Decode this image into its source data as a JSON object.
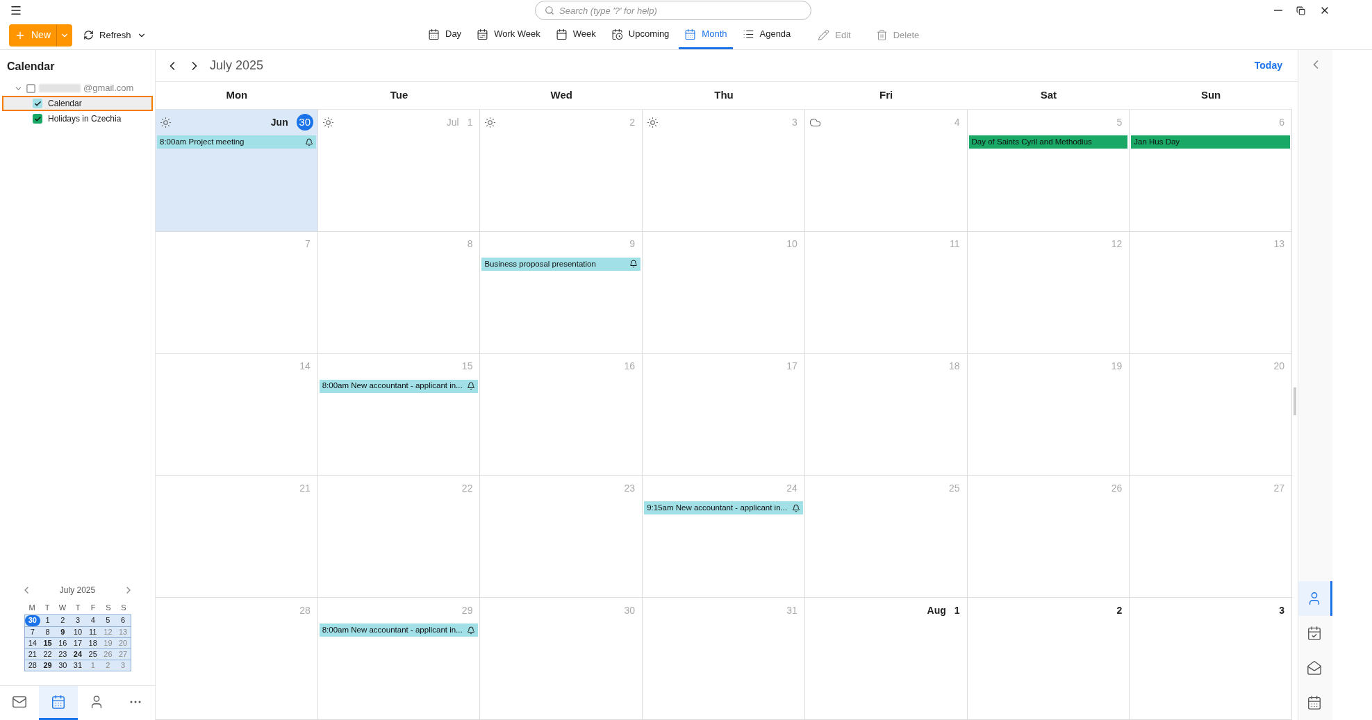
{
  "search": {
    "placeholder": "Search (type '?' for help)"
  },
  "toolbar": {
    "new_button": "New",
    "refresh_button": "Refresh",
    "views": [
      {
        "kind": "day",
        "label": "Day",
        "selected": false
      },
      {
        "kind": "workweek",
        "label": "Work Week",
        "selected": false
      },
      {
        "kind": "week",
        "label": "Week",
        "selected": false
      },
      {
        "kind": "upcoming",
        "label": "Upcoming",
        "selected": false
      },
      {
        "kind": "month",
        "label": "Month",
        "selected": true
      },
      {
        "kind": "agenda",
        "label": "Agenda",
        "selected": false
      }
    ],
    "actions": [
      {
        "kind": "edit",
        "label": "Edit",
        "disabled": true
      },
      {
        "kind": "delete",
        "label": "Delete",
        "disabled": true
      }
    ]
  },
  "sidebar": {
    "title": "Calendar",
    "account": {
      "label": "@gmail.com",
      "expanded": true,
      "calendars": [
        {
          "name": "Calendar",
          "checked": true,
          "selected": true,
          "color": "#a0e0e6"
        },
        {
          "name": "Holidays in Czechia",
          "checked": true,
          "selected": false,
          "color": "#1aa866"
        }
      ]
    },
    "mini_calendar": {
      "title": "July 2025",
      "weekdays": [
        "M",
        "T",
        "W",
        "T",
        "F",
        "S",
        "S"
      ],
      "weeks": [
        [
          {
            "day": "30",
            "today": true,
            "bold": false,
            "dimmed": false
          },
          {
            "day": "1",
            "today": false,
            "bold": false,
            "dimmed": false
          },
          {
            "day": "2",
            "today": false,
            "bold": false,
            "dimmed": false
          },
          {
            "day": "3",
            "today": false,
            "bold": false,
            "dimmed": false
          },
          {
            "day": "4",
            "today": false,
            "bold": false,
            "dimmed": false
          },
          {
            "day": "5",
            "today": false,
            "bold": false,
            "dimmed": false
          },
          {
            "day": "6",
            "today": false,
            "bold": false,
            "dimmed": false
          }
        ],
        [
          {
            "day": "7",
            "today": false,
            "bold": false,
            "dimmed": false
          },
          {
            "day": "8",
            "today": false,
            "bold": false,
            "dimmed": false
          },
          {
            "day": "9",
            "today": false,
            "bold": true,
            "dimmed": false
          },
          {
            "day": "10",
            "today": false,
            "bold": false,
            "dimmed": false
          },
          {
            "day": "11",
            "today": false,
            "bold": false,
            "dimmed": false
          },
          {
            "day": "12",
            "today": false,
            "bold": false,
            "dimmed": true
          },
          {
            "day": "13",
            "today": false,
            "bold": false,
            "dimmed": true
          }
        ],
        [
          {
            "day": "14",
            "today": false,
            "bold": false,
            "dimmed": false
          },
          {
            "day": "15",
            "today": false,
            "bold": true,
            "dimmed": false
          },
          {
            "day": "16",
            "today": false,
            "bold": false,
            "dimmed": false
          },
          {
            "day": "17",
            "today": false,
            "bold": false,
            "dimmed": false
          },
          {
            "day": "18",
            "today": false,
            "bold": false,
            "dimmed": false
          },
          {
            "day": "19",
            "today": false,
            "bold": false,
            "dimmed": true
          },
          {
            "day": "20",
            "today": false,
            "bold": false,
            "dimmed": true
          }
        ],
        [
          {
            "day": "21",
            "today": false,
            "bold": false,
            "dimmed": false
          },
          {
            "day": "22",
            "today": false,
            "bold": false,
            "dimmed": false
          },
          {
            "day": "23",
            "today": false,
            "bold": false,
            "dimmed": false
          },
          {
            "day": "24",
            "today": false,
            "bold": true,
            "dimmed": false
          },
          {
            "day": "25",
            "today": false,
            "bold": false,
            "dimmed": false
          },
          {
            "day": "26",
            "today": false,
            "bold": false,
            "dimmed": true
          },
          {
            "day": "27",
            "today": false,
            "bold": false,
            "dimmed": true
          }
        ],
        [
          {
            "day": "28",
            "today": false,
            "bold": false,
            "dimmed": false
          },
          {
            "day": "29",
            "today": false,
            "bold": true,
            "dimmed": false
          },
          {
            "day": "30",
            "today": false,
            "bold": false,
            "dimmed": false
          },
          {
            "day": "31",
            "today": false,
            "bold": false,
            "dimmed": false
          },
          {
            "day": "1",
            "today": false,
            "bold": false,
            "dimmed": true
          },
          {
            "day": "2",
            "today": false,
            "bold": false,
            "dimmed": true
          },
          {
            "day": "3",
            "today": false,
            "bold": false,
            "dimmed": true
          }
        ]
      ]
    }
  },
  "bottom_nav": [
    {
      "kind": "mail",
      "selected": false
    },
    {
      "kind": "calendar",
      "selected": true
    },
    {
      "kind": "contacts",
      "selected": false
    },
    {
      "kind": "more",
      "selected": false
    }
  ],
  "calendar": {
    "title": "July 2025",
    "today_button": "Today",
    "weekdays": [
      "Mon",
      "Tue",
      "Wed",
      "Thu",
      "Fri",
      "Sat",
      "Sun"
    ],
    "weeks": [
      [
        {
          "month": "Jun",
          "day": "30",
          "today": true,
          "dimmed": false,
          "weather": {
            "kind": "sun"
          },
          "events": [
            {
              "text": "8:00am Project meeting",
              "reminder": true,
              "color": "#a0e0e6"
            }
          ]
        },
        {
          "month": "Jul",
          "day": "1",
          "today": false,
          "dimmed": true,
          "weather": {
            "kind": "sun"
          }
        },
        {
          "day": "2",
          "today": false,
          "dimmed": true,
          "weather": {
            "kind": "sun"
          }
        },
        {
          "day": "3",
          "today": false,
          "dimmed": true,
          "weather": {
            "kind": "sun"
          }
        },
        {
          "day": "4",
          "today": false,
          "dimmed": true,
          "weather": {
            "kind": "cloud"
          }
        },
        {
          "day": "5",
          "today": false,
          "dimmed": true,
          "events": [
            {
              "text": "Day of Saints Cyril and Methodius",
              "reminder": false,
              "color": "#1aa866"
            }
          ]
        },
        {
          "day": "6",
          "today": false,
          "dimmed": true,
          "events": [
            {
              "text": "Jan Hus Day",
              "reminder": false,
              "color": "#1aa866"
            }
          ]
        }
      ],
      [
        {
          "day": "7",
          "today": false,
          "dimmed": true
        },
        {
          "day": "8",
          "today": false,
          "dimmed": true
        },
        {
          "day": "9",
          "today": false,
          "dimmed": true,
          "events": [
            {
              "text": "Business proposal presentation",
              "reminder": true,
              "color": "#a0e0e6"
            }
          ]
        },
        {
          "day": "10",
          "today": false,
          "dimmed": true
        },
        {
          "day": "11",
          "today": false,
          "dimmed": true
        },
        {
          "day": "12",
          "today": false,
          "dimmed": true
        },
        {
          "day": "13",
          "today": false,
          "dimmed": true
        }
      ],
      [
        {
          "day": "14",
          "today": false,
          "dimmed": true
        },
        {
          "day": "15",
          "today": false,
          "dimmed": true,
          "events": [
            {
              "text": "8:00am New accountant - applicant in...",
              "reminder": true,
              "color": "#a0e0e6"
            }
          ]
        },
        {
          "day": "16",
          "today": false,
          "dimmed": true
        },
        {
          "day": "17",
          "today": false,
          "dimmed": true
        },
        {
          "day": "18",
          "today": false,
          "dimmed": true
        },
        {
          "day": "19",
          "today": false,
          "dimmed": true
        },
        {
          "day": "20",
          "today": false,
          "dimmed": true
        }
      ],
      [
        {
          "day": "21",
          "today": false,
          "dimmed": true
        },
        {
          "day": "22",
          "today": false,
          "dimmed": true
        },
        {
          "day": "23",
          "today": false,
          "dimmed": true
        },
        {
          "day": "24",
          "today": false,
          "dimmed": true,
          "events": [
            {
              "text": "9:15am New accountant - applicant in...",
              "reminder": true,
              "color": "#a0e0e6"
            }
          ]
        },
        {
          "day": "25",
          "today": false,
          "dimmed": true
        },
        {
          "day": "26",
          "today": false,
          "dimmed": true
        },
        {
          "day": "27",
          "today": false,
          "dimmed": true
        }
      ],
      [
        {
          "day": "28",
          "today": false,
          "dimmed": true
        },
        {
          "day": "29",
          "today": false,
          "dimmed": true,
          "events": [
            {
              "text": "8:00am New accountant - applicant in...",
              "reminder": true,
              "color": "#a0e0e6"
            }
          ]
        },
        {
          "day": "30",
          "today": false,
          "dimmed": true
        },
        {
          "day": "31",
          "today": false,
          "dimmed": true
        },
        {
          "month": "Aug",
          "day": "1",
          "today": false,
          "dimmed": false
        },
        {
          "day": "2",
          "today": false,
          "dimmed": false
        },
        {
          "day": "3",
          "today": false,
          "dimmed": false
        }
      ]
    ]
  },
  "right_rail": [
    {
      "kind": "contacts",
      "selected": true
    },
    {
      "kind": "tasks",
      "selected": false
    },
    {
      "kind": "mail",
      "selected": false
    },
    {
      "kind": "calendar",
      "selected": false
    }
  ]
}
